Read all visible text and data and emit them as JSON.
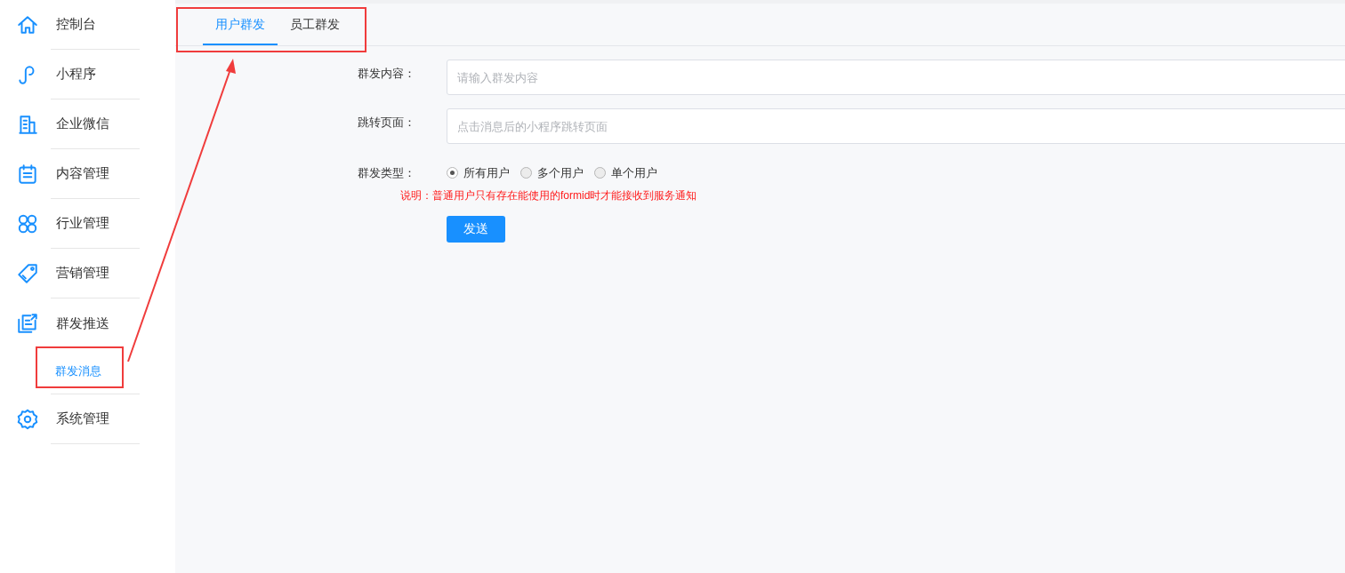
{
  "sidebar": {
    "items": [
      {
        "label": "控制台"
      },
      {
        "label": "小程序"
      },
      {
        "label": "企业微信"
      },
      {
        "label": "内容管理"
      },
      {
        "label": "行业管理"
      },
      {
        "label": "营销管理"
      },
      {
        "label": "群发推送",
        "children": [
          {
            "label": "群发消息",
            "selected": true
          }
        ]
      },
      {
        "label": "系统管理"
      }
    ]
  },
  "tabs": [
    {
      "label": "用户群发",
      "selected": true
    },
    {
      "label": "员工群发",
      "selected": false
    }
  ],
  "form": {
    "content": {
      "label": "群发内容：",
      "placeholder": "请输入群发内容"
    },
    "page": {
      "label": "跳转页面：",
      "placeholder": "点击消息后的小程序跳转页面"
    },
    "type": {
      "label": "群发类型：",
      "options": [
        {
          "label": "所有用户",
          "selected": true
        },
        {
          "label": "多个用户",
          "selected": false
        },
        {
          "label": "单个用户",
          "selected": false
        }
      ]
    },
    "note": "说明：普通用户只有存在能使用的formid时才能接收到服务通知",
    "submit": "发送"
  }
}
